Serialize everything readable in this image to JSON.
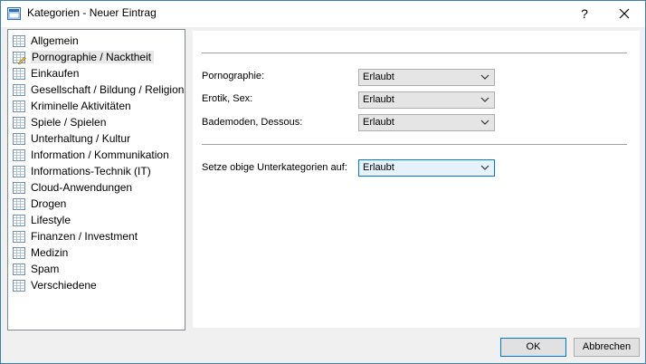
{
  "window": {
    "title": "Kategorien - Neuer Eintrag",
    "help_label": "?",
    "close_label": "✕"
  },
  "categories": [
    {
      "label": "Allgemein",
      "icon": "grid-icon",
      "selected": false
    },
    {
      "label": "Pornographie / Nacktheit",
      "icon": "grid-pencil-icon",
      "selected": true
    },
    {
      "label": "Einkaufen",
      "icon": "grid-icon",
      "selected": false
    },
    {
      "label": "Gesellschaft / Bildung / Religion",
      "icon": "grid-icon",
      "selected": false
    },
    {
      "label": "Kriminelle Aktivitäten",
      "icon": "grid-icon",
      "selected": false
    },
    {
      "label": "Spiele / Spielen",
      "icon": "grid-icon",
      "selected": false
    },
    {
      "label": "Unterhaltung / Kultur",
      "icon": "grid-icon",
      "selected": false
    },
    {
      "label": "Information / Kommunikation",
      "icon": "grid-icon",
      "selected": false
    },
    {
      "label": "Informations-Technik (IT)",
      "icon": "grid-icon",
      "selected": false
    },
    {
      "label": "Cloud-Anwendungen",
      "icon": "grid-icon",
      "selected": false
    },
    {
      "label": "Drogen",
      "icon": "grid-icon",
      "selected": false
    },
    {
      "label": "Lifestyle",
      "icon": "grid-icon",
      "selected": false
    },
    {
      "label": "Finanzen / Investment",
      "icon": "grid-icon",
      "selected": false
    },
    {
      "label": "Medizin",
      "icon": "grid-icon",
      "selected": false
    },
    {
      "label": "Spam",
      "icon": "grid-icon",
      "selected": false
    },
    {
      "label": "Verschiedene",
      "icon": "grid-icon",
      "selected": false
    }
  ],
  "subcategories": [
    {
      "label": "Pornographie:",
      "value": "Erlaubt"
    },
    {
      "label": "Erotik, Sex:",
      "value": "Erlaubt"
    },
    {
      "label": "Bademoden, Dessous:",
      "value": "Erlaubt"
    }
  ],
  "set_all": {
    "label": "Setze obige Unterkategorien auf:",
    "value": "Erlaubt"
  },
  "buttons": {
    "ok": "OK",
    "cancel": "Abbrechen"
  },
  "colors": {
    "accent": "#0078d7",
    "selected_bg": "#e8e8e8"
  }
}
